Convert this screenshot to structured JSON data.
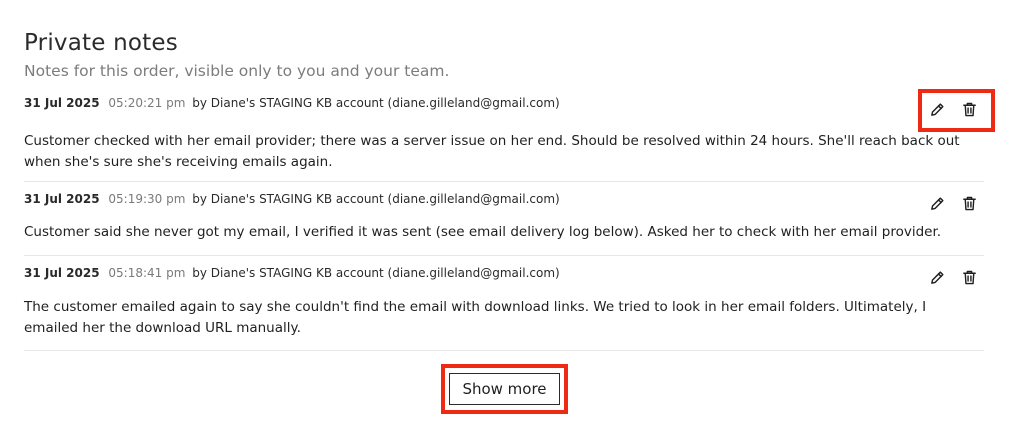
{
  "header": {
    "title": "Private notes",
    "subtitle": "Notes for this order, visible only to you and your team."
  },
  "notes": [
    {
      "date": "31 Jul 2025",
      "time": "05:20:21 pm",
      "author": "by Diane's STAGING KB account (diane.gilleland@gmail.com)",
      "text": "Customer checked with her email provider; there was a server issue on her end. Should be resolved within 24 hours. She'll reach back out when she's sure she's receiving emails again."
    },
    {
      "date": "31 Jul 2025",
      "time": "05:19:30 pm",
      "author": "by Diane's STAGING KB account (diane.gilleland@gmail.com)",
      "text": "Customer said she never got my email, I verified it was sent (see email delivery log below). Asked her to check with her email provider."
    },
    {
      "date": "31 Jul 2025",
      "time": "05:18:41 pm",
      "author": "by Diane's STAGING KB account (diane.gilleland@gmail.com)",
      "text": "The customer emailed again to say she couldn't find the email with download links. We tried to look in her email folders. Ultimately, I emailed her the download URL manually."
    }
  ],
  "icons": {
    "edit": "pencil-icon",
    "delete": "trash-icon"
  },
  "show_more_label": "Show more",
  "colors": {
    "highlight": "#ee2a15",
    "divider": "#e6e6e6",
    "muted_text": "#7a7a7a"
  }
}
